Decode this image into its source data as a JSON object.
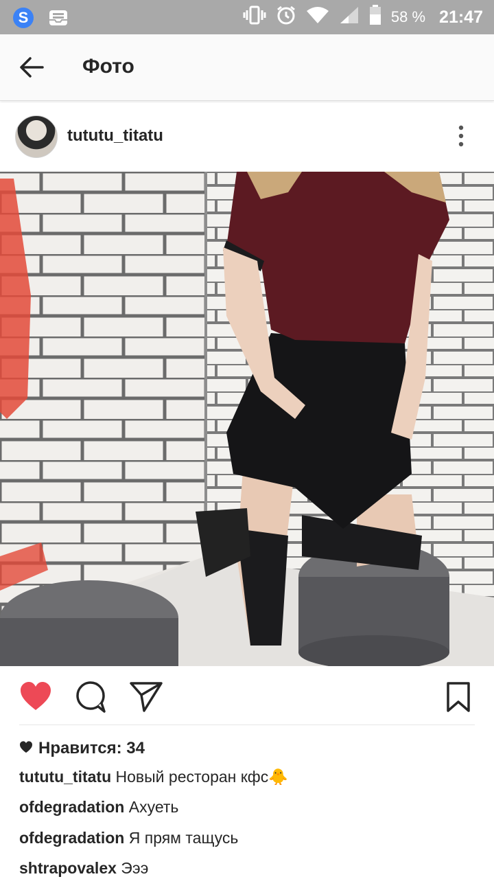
{
  "status_bar": {
    "battery_percent": "58 %",
    "time": "21:47",
    "icons": [
      "s-app-icon",
      "inbox-tray-icon",
      "vibrate-icon",
      "alarm-icon",
      "wifi-icon",
      "signal-icon",
      "battery-icon"
    ]
  },
  "app_bar": {
    "title": "Фото"
  },
  "post": {
    "username": "tututu_titatu",
    "likes_text": "Нравится: 34",
    "liked": true,
    "caption": {
      "user": "tututu_titatu",
      "text": "Новый ресторан кфс",
      "emoji": "🐥"
    },
    "comments": [
      {
        "user": "ofdegradation",
        "text": "Ахуеть"
      },
      {
        "user": "ofdegradation",
        "text": "Я прям тащусь"
      },
      {
        "user": "shtrapovalex",
        "text": "Эээ"
      }
    ]
  },
  "colors": {
    "status_bar_bg": "#a9a9a9",
    "like_red": "#ed4956",
    "text": "#262626",
    "shirt": "#5c1a22"
  }
}
